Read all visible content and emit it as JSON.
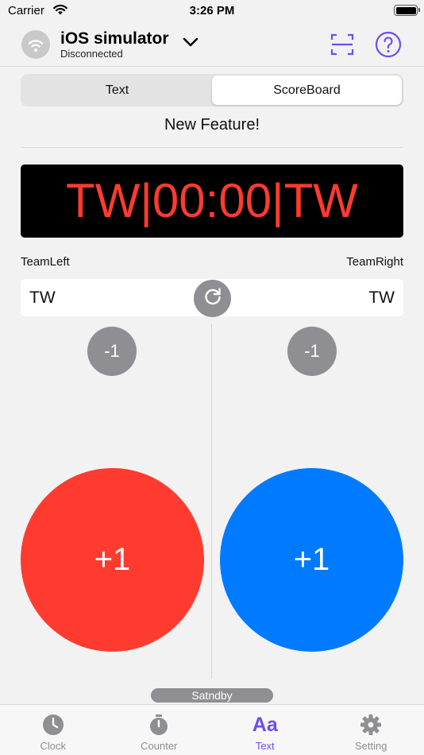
{
  "status_bar": {
    "carrier": "Carrier",
    "time": "3:26 PM"
  },
  "header": {
    "device_name": "iOS simulator",
    "device_status": "Disconnected",
    "icons": [
      "wifi-icon",
      "chevron-down-icon",
      "scan-icon",
      "help-icon"
    ]
  },
  "segmented": {
    "options": [
      "Text",
      "ScoreBoard"
    ],
    "selected": "ScoreBoard"
  },
  "feature_title": "New Feature!",
  "scoreboard": {
    "display_text": "TW|00:00|TW",
    "display_color": "#ff3b30",
    "team_left_label": "TeamLeft",
    "team_right_label": "TeamRight",
    "team_left_value": "TW",
    "team_right_value": "TW",
    "minus_label": "-1",
    "plus_label": "+1",
    "left_color": "#ff3b30",
    "right_color": "#007aff"
  },
  "standby": "Satndby",
  "tabs": [
    {
      "label": "Clock",
      "icon": "clock-icon"
    },
    {
      "label": "Counter",
      "icon": "stopwatch-icon"
    },
    {
      "label": "Text",
      "icon": "text-icon"
    },
    {
      "label": "Setting",
      "icon": "gear-icon"
    }
  ],
  "active_tab": "Text",
  "accent_color": "#6e4cf0"
}
